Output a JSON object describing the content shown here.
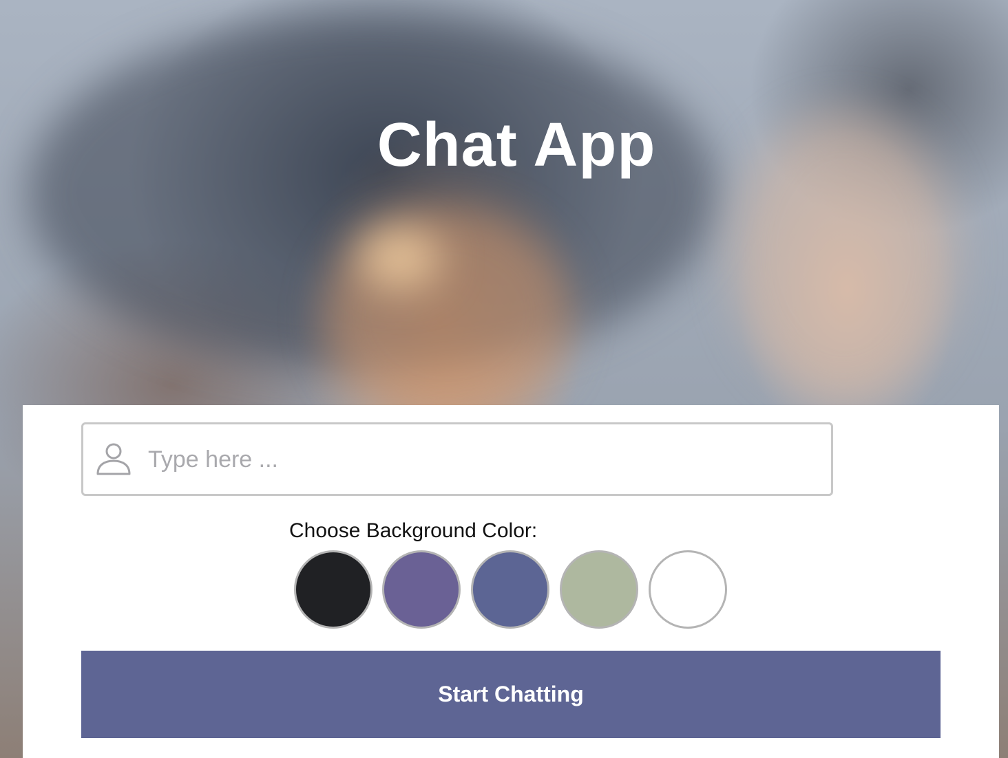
{
  "title": "Chat App",
  "name_input": {
    "placeholder": "Type here ...",
    "value": ""
  },
  "color_chooser": {
    "label": "Choose Background Color:",
    "options": [
      {
        "name": "black",
        "color": "#202124"
      },
      {
        "name": "purple",
        "color": "#6a6195"
      },
      {
        "name": "blue-gray",
        "color": "#5c6594"
      },
      {
        "name": "sage-green",
        "color": "#aeb89f"
      },
      {
        "name": "white",
        "color": "#ffffff"
      }
    ]
  },
  "start_button": {
    "label": "Start Chatting",
    "color": "#5e6594"
  },
  "icons": {
    "name_input_icon": "person-icon"
  }
}
